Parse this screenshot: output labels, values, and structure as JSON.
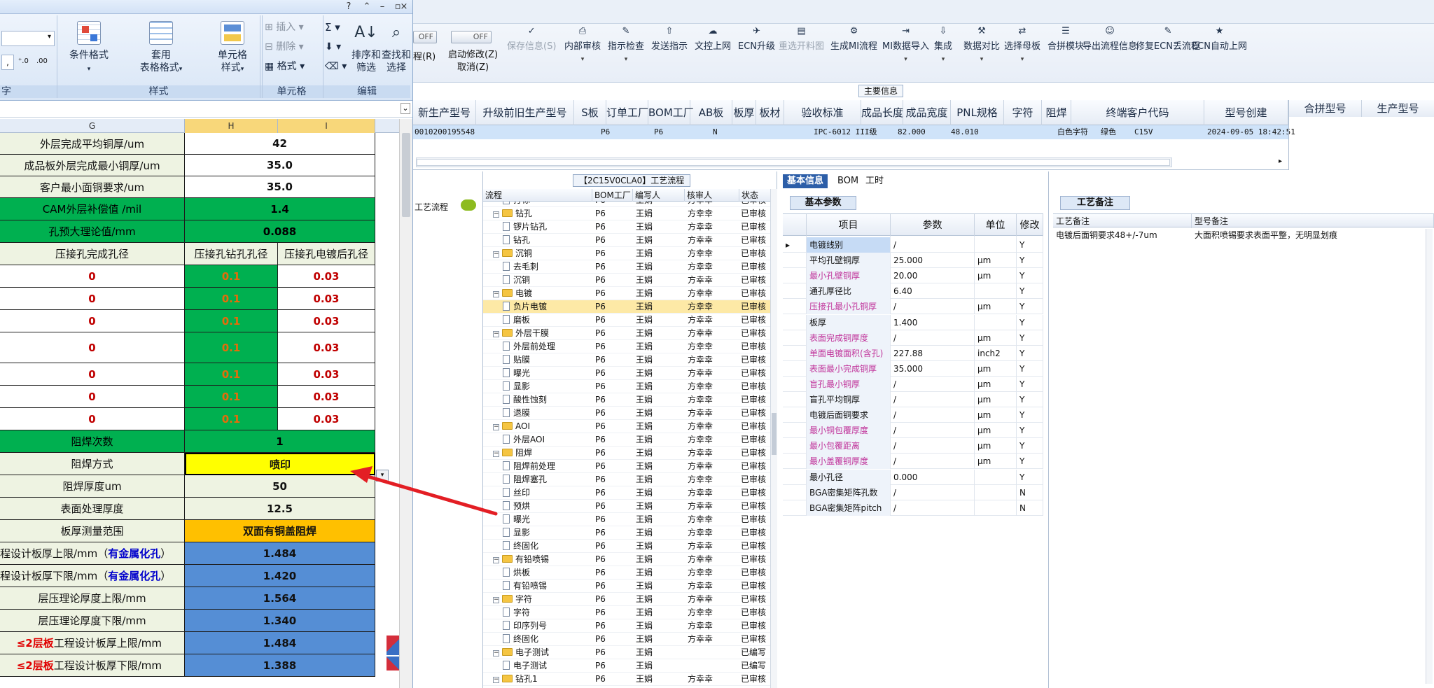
{
  "excel": {
    "ribbon": {
      "left_partial_label": "字",
      "conditional_format": "条件格式",
      "table_format_l1": "套用",
      "table_format_l2": "表格格式",
      "cell_style_l1": "单元格",
      "cell_style_l2": "样式",
      "insert": "插入",
      "delete": "删除",
      "format": "格式",
      "sort_filter_l1": "排序和",
      "sort_filter_l2": "筛选",
      "find_select_l1": "查找和",
      "find_select_l2": "选择",
      "group_styles": "样式",
      "group_cells": "单元格",
      "group_edit": "编辑",
      "sigma": "Σ"
    },
    "columns": [
      "G",
      "H",
      "I"
    ],
    "rows": [
      {
        "g": "外层完成平均铜厚/um",
        "hi": "42",
        "style": "white"
      },
      {
        "g": "成品板外层完成最小铜厚/um",
        "hi": "35.0",
        "style": "white"
      },
      {
        "g": "客户最小面铜要求/um",
        "hi": "35.0",
        "style": "white"
      },
      {
        "g": "CAM外层补偿值 /mil",
        "hi": "1.4",
        "style": "green"
      },
      {
        "g": "孔预大理论值/mm",
        "hi": "0.088",
        "style": "green"
      },
      {
        "g": "压接孔完成孔径",
        "h": "压接孔钻孔孔径",
        "i": "压接孔电镀后孔径",
        "style": "header"
      },
      {
        "g": "0",
        "h": "0.1",
        "i": "0.03",
        "style": "data"
      },
      {
        "g": "0",
        "h": "0.1",
        "i": "0.03",
        "style": "data"
      },
      {
        "g": "0",
        "h": "0.1",
        "i": "0.03",
        "style": "data"
      },
      {
        "g": "0",
        "h": "0.1",
        "i": "0.03",
        "style": "data"
      },
      {
        "g": "0",
        "h": "0.1",
        "i": "0.03",
        "style": "data"
      },
      {
        "g": "0",
        "h": "0.1",
        "i": "0.03",
        "style": "data"
      },
      {
        "g": "0",
        "h": "0.1",
        "i": "0.03",
        "style": "data"
      },
      {
        "g": "阻焊次数",
        "hi": "1",
        "style": "green"
      },
      {
        "g": "阻焊方式",
        "hi": "喷印",
        "style": "yellow"
      },
      {
        "g": "阻焊厚度um",
        "hi": "50",
        "style": "light"
      },
      {
        "g": "表面处理厚度",
        "hi": "12.5",
        "style": "light"
      },
      {
        "g": "板厚测量范围",
        "hi": "双面有铜盖阻焊",
        "style": "orange"
      },
      {
        "g_pre": "程设计板厚上限/mm（",
        "g_blue": "有金属化孔",
        "g_post": "）",
        "hi": "1.484",
        "style": "blue"
      },
      {
        "g_pre": "程设计板厚下限/mm（",
        "g_blue": "有金属化孔",
        "g_post": "）",
        "hi": "1.420",
        "style": "blue"
      },
      {
        "g": "层压理论厚度上限/mm",
        "hi": "1.564",
        "style": "blue"
      },
      {
        "g": "层压理论厚度下限/mm",
        "hi": "1.340",
        "style": "blue"
      },
      {
        "g_red": "≤2层板",
        "g_post": "工程设计板厚上限/mm",
        "hi": "1.484",
        "style": "blue"
      },
      {
        "g_red": "≤2层板",
        "g_post": "工程设计板厚下限/mm",
        "hi": "1.388",
        "style": "blue"
      }
    ]
  },
  "erp": {
    "toggles": [
      "OFF",
      "OFF"
    ],
    "toolbar_left_partial": "程(R)",
    "start_modify_l1": "启动修改(Z)",
    "start_modify_l2": "取消(Z)",
    "toolbar": [
      {
        "label": "保存信息(S)",
        "disabled": true
      },
      {
        "label": "内部审核",
        "arrow": true
      },
      {
        "label": "指示检查",
        "arrow": true
      },
      {
        "label": "发送指示"
      },
      {
        "label": "文控上网"
      },
      {
        "label": "ECN升级"
      },
      {
        "label": "重选开料图",
        "disabled": true
      },
      {
        "label": "生成MI流程"
      },
      {
        "label": "MI数据导入",
        "arrow": true
      },
      {
        "label": "集成",
        "arrow": true
      },
      {
        "label": "数据对比",
        "arrow": true
      },
      {
        "label": "选择母板",
        "arrow": true
      },
      {
        "label": "合拼模块"
      },
      {
        "label": "导出流程信息"
      },
      {
        "label": "修复ECN丢流程"
      },
      {
        "label": "ECN自动上网"
      }
    ],
    "main_info_tab": "主要信息",
    "main_headers": [
      "新生产型号",
      "升级前旧生产型号",
      "S板",
      "订单工厂",
      "BOM工厂",
      "AB板",
      "板厚",
      "板材",
      "验收标准",
      "成品长度",
      "成品宽度",
      "PNL规格",
      "字符",
      "阻焊",
      "终端客户代码",
      "型号创建"
    ],
    "main_row": {
      "model": "0010200195548",
      "factory": "P6",
      "bom": "P6",
      "ab": "N",
      "standard": "IPC-6012 III级",
      "length": "82.000",
      "width": "48.010",
      "char": "白色字符",
      "mask": "绿色",
      "client": "C15V",
      "created": "2024-09-05 18:42:51"
    },
    "right_headers": [
      "合拼型号",
      "生产型号"
    ],
    "left_strip_label": "工艺流程",
    "process": {
      "title": "【2C15V0CLA0】工艺流程",
      "headers": [
        "流程",
        "BOM工厂",
        "编写人",
        "核审人",
        "状态"
      ],
      "rows": [
        {
          "name": "打标",
          "level": 2,
          "bom": "P6",
          "writer": "王娟",
          "reviewer": "方幸幸",
          "status": "已审核"
        },
        {
          "name": "钻孔",
          "level": 1,
          "bom": "P6",
          "writer": "王娟",
          "reviewer": "方幸幸",
          "status": "已审核"
        },
        {
          "name": "锣片钻孔",
          "level": 2,
          "bom": "P6",
          "writer": "王娟",
          "reviewer": "方幸幸",
          "status": "已审核"
        },
        {
          "name": "钻孔",
          "level": 2,
          "bom": "P6",
          "writer": "王娟",
          "reviewer": "方幸幸",
          "status": "已审核"
        },
        {
          "name": "沉铜",
          "level": 1,
          "bom": "P6",
          "writer": "王娟",
          "reviewer": "方幸幸",
          "status": "已审核"
        },
        {
          "name": "去毛刺",
          "level": 2,
          "bom": "P6",
          "writer": "王娟",
          "reviewer": "方幸幸",
          "status": "已审核"
        },
        {
          "name": "沉铜",
          "level": 2,
          "bom": "P6",
          "writer": "王娟",
          "reviewer": "方幸幸",
          "status": "已审核"
        },
        {
          "name": "电镀",
          "level": 1,
          "bom": "P6",
          "writer": "王娟",
          "reviewer": "方幸幸",
          "status": "已审核"
        },
        {
          "name": "负片电镀",
          "level": 2,
          "bom": "P6",
          "writer": "王娟",
          "reviewer": "方幸幸",
          "status": "已审核",
          "selected": true
        },
        {
          "name": "磨板",
          "level": 2,
          "bom": "P6",
          "writer": "王娟",
          "reviewer": "方幸幸",
          "status": "已审核"
        },
        {
          "name": "外层干膜",
          "level": 1,
          "bom": "P6",
          "writer": "王娟",
          "reviewer": "方幸幸",
          "status": "已审核"
        },
        {
          "name": "外层前处理",
          "level": 2,
          "bom": "P6",
          "writer": "王娟",
          "reviewer": "方幸幸",
          "status": "已审核"
        },
        {
          "name": "贴膜",
          "level": 2,
          "bom": "P6",
          "writer": "王娟",
          "reviewer": "方幸幸",
          "status": "已审核"
        },
        {
          "name": "曝光",
          "level": 2,
          "bom": "P6",
          "writer": "王娟",
          "reviewer": "方幸幸",
          "status": "已审核"
        },
        {
          "name": "显影",
          "level": 2,
          "bom": "P6",
          "writer": "王娟",
          "reviewer": "方幸幸",
          "status": "已审核"
        },
        {
          "name": "酸性蚀刻",
          "level": 2,
          "bom": "P6",
          "writer": "王娟",
          "reviewer": "方幸幸",
          "status": "已审核"
        },
        {
          "name": "退膜",
          "level": 2,
          "bom": "P6",
          "writer": "王娟",
          "reviewer": "方幸幸",
          "status": "已审核"
        },
        {
          "name": "AOI",
          "level": 1,
          "bom": "P6",
          "writer": "王娟",
          "reviewer": "方幸幸",
          "status": "已审核"
        },
        {
          "name": "外层AOI",
          "level": 2,
          "bom": "P6",
          "writer": "王娟",
          "reviewer": "方幸幸",
          "status": "已审核"
        },
        {
          "name": "阻焊",
          "level": 1,
          "bom": "P6",
          "writer": "王娟",
          "reviewer": "方幸幸",
          "status": "已审核"
        },
        {
          "name": "阻焊前处理",
          "level": 2,
          "bom": "P6",
          "writer": "王娟",
          "reviewer": "方幸幸",
          "status": "已审核"
        },
        {
          "name": "阻焊塞孔",
          "level": 2,
          "bom": "P6",
          "writer": "王娟",
          "reviewer": "方幸幸",
          "status": "已审核"
        },
        {
          "name": "丝印",
          "level": 2,
          "bom": "P6",
          "writer": "王娟",
          "reviewer": "方幸幸",
          "status": "已审核"
        },
        {
          "name": "预烘",
          "level": 2,
          "bom": "P6",
          "writer": "王娟",
          "reviewer": "方幸幸",
          "status": "已审核"
        },
        {
          "name": "曝光",
          "level": 2,
          "bom": "P6",
          "writer": "王娟",
          "reviewer": "方幸幸",
          "status": "已审核"
        },
        {
          "name": "显影",
          "level": 2,
          "bom": "P6",
          "writer": "王娟",
          "reviewer": "方幸幸",
          "status": "已审核"
        },
        {
          "name": "终固化",
          "level": 2,
          "bom": "P6",
          "writer": "王娟",
          "reviewer": "方幸幸",
          "status": "已审核"
        },
        {
          "name": "有铅喷锡",
          "level": 1,
          "bom": "P6",
          "writer": "王娟",
          "reviewer": "方幸幸",
          "status": "已审核"
        },
        {
          "name": "烘板",
          "level": 2,
          "bom": "P6",
          "writer": "王娟",
          "reviewer": "方幸幸",
          "status": "已审核"
        },
        {
          "name": "有铅喷锡",
          "level": 2,
          "bom": "P6",
          "writer": "王娟",
          "reviewer": "方幸幸",
          "status": "已审核"
        },
        {
          "name": "字符",
          "level": 1,
          "bom": "P6",
          "writer": "王娟",
          "reviewer": "方幸幸",
          "status": "已审核"
        },
        {
          "name": "字符",
          "level": 2,
          "bom": "P6",
          "writer": "王娟",
          "reviewer": "方幸幸",
          "status": "已审核"
        },
        {
          "name": "印序列号",
          "level": 2,
          "bom": "P6",
          "writer": "王娟",
          "reviewer": "方幸幸",
          "status": "已审核"
        },
        {
          "name": "终固化",
          "level": 2,
          "bom": "P6",
          "writer": "王娟",
          "reviewer": "方幸幸",
          "status": "已审核"
        },
        {
          "name": "电子测试",
          "level": 1,
          "bom": "P6",
          "writer": "王娟",
          "reviewer": "",
          "status": "已编写"
        },
        {
          "name": "电子测试",
          "level": 2,
          "bom": "P6",
          "writer": "王娟",
          "reviewer": "",
          "status": "已编写"
        },
        {
          "name": "钻孔1",
          "level": 1,
          "bom": "P6",
          "writer": "王娟",
          "reviewer": "方幸幸",
          "status": "已审核"
        }
      ]
    },
    "basic": {
      "tabs": [
        "基本信息",
        "BOM",
        "工时"
      ],
      "sub_tab": "基本参数",
      "headers": [
        "项目",
        "参数",
        "单位",
        "修改"
      ],
      "rows": [
        {
          "item": "电镀线别",
          "param": "/",
          "unit": "",
          "mod": "Y",
          "pink": false,
          "current": true
        },
        {
          "item": "平均孔壁铜厚",
          "param": "25.000",
          "unit": "μm",
          "mod": "Y",
          "pink": false
        },
        {
          "item": "最小孔壁铜厚",
          "param": "20.00",
          "unit": "μm",
          "mod": "Y",
          "pink": true
        },
        {
          "item": "通孔厚径比",
          "param": "6.40",
          "unit": "",
          "mod": "Y",
          "pink": false
        },
        {
          "item": "压接孔最小孔铜厚",
          "param": "/",
          "unit": "μm",
          "mod": "Y",
          "pink": true
        },
        {
          "item": "板厚",
          "param": "1.400",
          "unit": "",
          "mod": "Y",
          "pink": false
        },
        {
          "item": "表面完成铜厚度",
          "param": "/",
          "unit": "μm",
          "mod": "Y",
          "pink": true
        },
        {
          "item": "单面电镀面积(含孔)",
          "param": "227.88",
          "unit": "inch2",
          "mod": "Y",
          "pink": true
        },
        {
          "item": "表面最小完成铜厚",
          "param": "35.000",
          "unit": "μm",
          "mod": "Y",
          "pink": true
        },
        {
          "item": "盲孔最小铜厚",
          "param": "/",
          "unit": "μm",
          "mod": "Y",
          "pink": true
        },
        {
          "item": "盲孔平均铜厚",
          "param": "/",
          "unit": "μm",
          "mod": "Y",
          "pink": false
        },
        {
          "item": "电镀后面铜要求",
          "param": "/",
          "unit": "μm",
          "mod": "Y",
          "pink": false
        },
        {
          "item": "最小铜包覆厚度",
          "param": "/",
          "unit": "μm",
          "mod": "Y",
          "pink": true
        },
        {
          "item": "最小包覆距离",
          "param": "/",
          "unit": "μm",
          "mod": "Y",
          "pink": true
        },
        {
          "item": "最小盖覆铜厚度",
          "param": "/",
          "unit": "μm",
          "mod": "Y",
          "pink": true
        },
        {
          "item": "最小孔径",
          "param": "0.000",
          "unit": "",
          "mod": "Y",
          "pink": false
        },
        {
          "item": "BGA密集矩阵孔数",
          "param": "/",
          "unit": "",
          "mod": "N",
          "pink": false
        },
        {
          "item": "BGA密集矩阵pitch",
          "param": "/",
          "unit": "",
          "mod": "N",
          "pink": false
        }
      ]
    },
    "note": {
      "sub_tab": "工艺备注",
      "headers": [
        "工艺备注",
        "型号备注"
      ],
      "process_note": "电镀后面铜要求48+/-7um",
      "model_note": "大面积喷锡要求表面平整，无明显划痕"
    }
  }
}
